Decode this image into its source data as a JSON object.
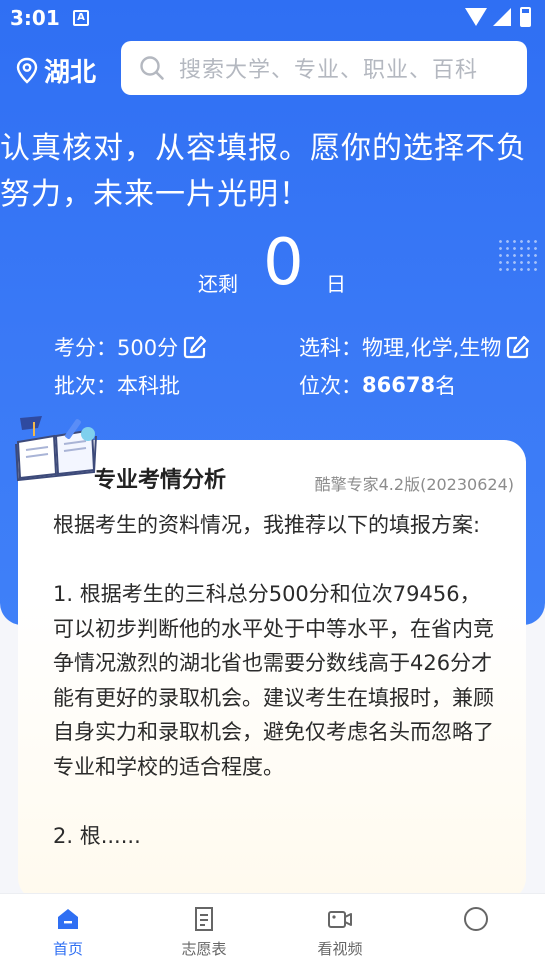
{
  "status_bar": {
    "time": "3:01",
    "a_icon": "A"
  },
  "header": {
    "city": "湖北",
    "search_placeholder": "搜索大学、专业、职业、百科"
  },
  "slogan": {
    "line1": "认真核对，从容填报。愿你的选择不负",
    "line2": "努力，未来一片光明！"
  },
  "countdown": {
    "prefix": "还剩",
    "days": "0",
    "unit": "日"
  },
  "info": {
    "score_label": "考分：",
    "score_value": "500分",
    "subjects_label": "选科：",
    "subjects_value": "物理,化学,生物",
    "batch_label": "批次：",
    "batch_value": "本科批",
    "rank_label": "位次：",
    "rank_value": "86678",
    "rank_unit": "名"
  },
  "card": {
    "title": "专业考情分析",
    "version": "酷擎专家4.2版(20230624)",
    "paragraphs": [
      "根据考生的资料情况，我推荐以下的填报方案:",
      "1. 根据考生的三科总分500分和位次79456，可以初步判断他的水平处于中等水平，在省内竞争情况激烈的湖北省也需要分数线高于426分才能有更好的录取机会。建议考生在填报时，兼顾自身实力和录取机会，避免仅考虑名头而忽略了专业和学校的适合程度。",
      "2. 根......"
    ]
  },
  "nav": {
    "items": [
      {
        "label": "首页",
        "icon": "home-icon",
        "active": true
      },
      {
        "label": "志愿表",
        "icon": "form-icon",
        "active": false
      },
      {
        "label": "看视频",
        "icon": "video-icon",
        "active": false
      },
      {
        "label": "",
        "icon": "profile-icon",
        "active": false
      }
    ]
  },
  "colors": {
    "primary": "#2f6ff3",
    "card_tint": "#fffaee"
  }
}
